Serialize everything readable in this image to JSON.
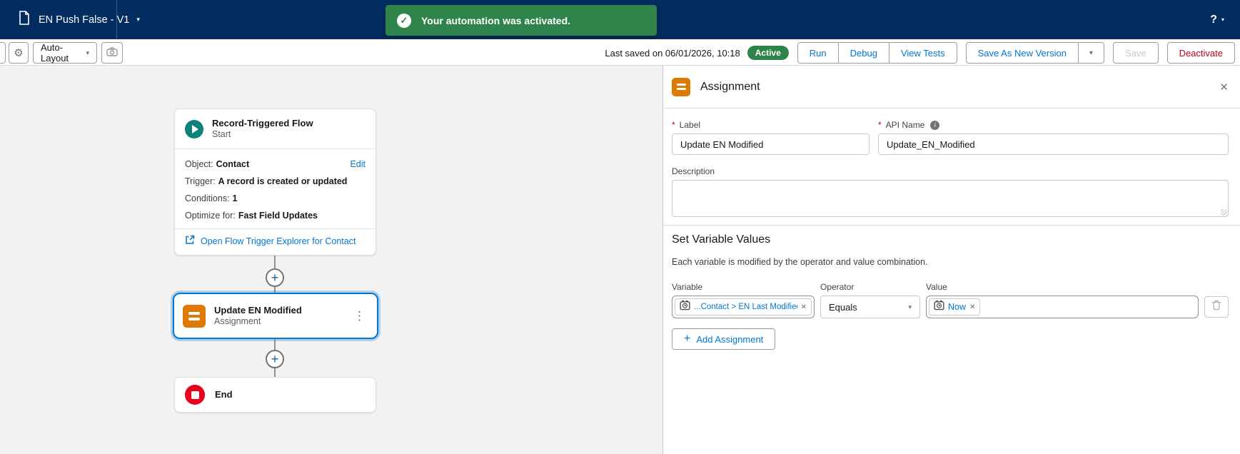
{
  "navbar": {
    "flow_name": "EN Push False - V1",
    "toast": {
      "message": "Your automation was activated."
    },
    "help_label": "?"
  },
  "toolbar": {
    "auto_layout_label": "Auto-Layout",
    "last_saved": "Last saved on 06/01/2026, 10:18",
    "status_badge": "Active",
    "buttons": {
      "run": "Run",
      "debug": "Debug",
      "view_tests": "View Tests",
      "save_as_new_version": "Save As New Version",
      "save": "Save",
      "deactivate": "Deactivate"
    }
  },
  "canvas": {
    "start_node": {
      "title": "Record-Triggered Flow",
      "subtitle": "Start",
      "edit_label": "Edit",
      "rows": [
        {
          "label": "Object:",
          "value": "Contact"
        },
        {
          "label": "Trigger:",
          "value": "A record is created or updated"
        },
        {
          "label": "Conditions:",
          "value": "1"
        },
        {
          "label": "Optimize for:",
          "value": "Fast Field Updates"
        }
      ],
      "link": "Open Flow Trigger Explorer for Contact"
    },
    "assignment_node": {
      "title": "Update EN Modified",
      "subtitle": "Assignment"
    },
    "end_node": {
      "title": "End"
    }
  },
  "panel": {
    "title": "Assignment",
    "required_marker": "*",
    "fields": {
      "label": {
        "label": "Label",
        "value": "Update EN Modified"
      },
      "api_name": {
        "label": "API Name",
        "value": "Update_EN_Modified"
      },
      "description": {
        "label": "Description",
        "value": ""
      }
    },
    "section": {
      "title": "Set Variable Values",
      "helper": "Each variable is modified by the operator and value combination.",
      "columns": {
        "variable": "Variable",
        "operator": "Operator",
        "value": "Value"
      },
      "row": {
        "variable_pill": "...Contact > EN Last Modified Date",
        "operator_value": "Equals",
        "value_pill": "Now"
      },
      "add_label": "Add Assignment"
    }
  },
  "icons": {
    "caret_down": "▾",
    "close": "✕",
    "kebab": "⋮",
    "plus": "+",
    "check": "✓",
    "gear": "⚙",
    "info": "i"
  },
  "colors": {
    "navbar_navy": "#032D60",
    "toast_green": "#2E844A",
    "active_badge_green": "#2E844A",
    "link_blue": "#0176D3",
    "start_node_teal": "#0B827C",
    "assignment_orange": "#DD7A01",
    "end_node_red": "#EA001E",
    "deactivate_red": "#BA0517",
    "canvas_gray": "#F3F2F2"
  }
}
